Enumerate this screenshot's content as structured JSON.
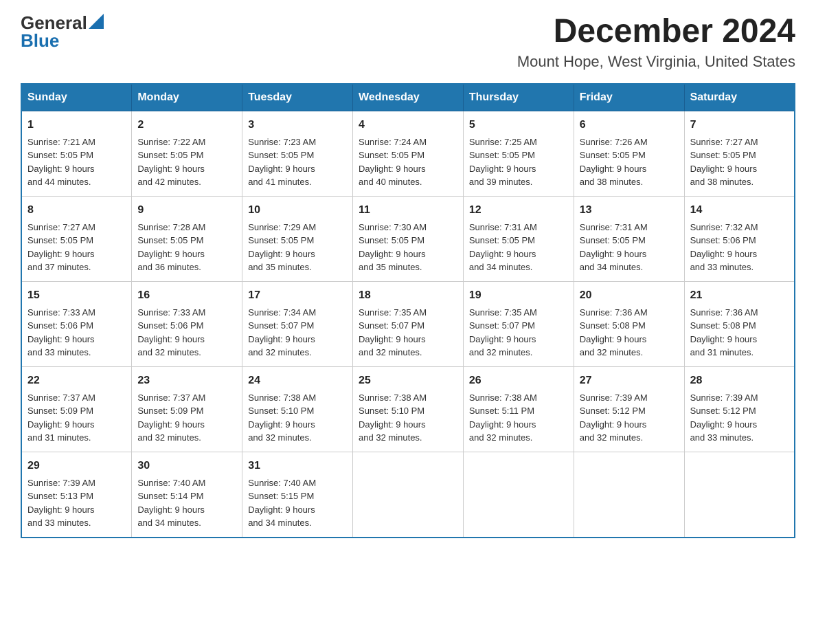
{
  "header": {
    "logo_general": "General",
    "logo_blue": "Blue",
    "month_title": "December 2024",
    "location": "Mount Hope, West Virginia, United States"
  },
  "weekdays": [
    "Sunday",
    "Monday",
    "Tuesday",
    "Wednesday",
    "Thursday",
    "Friday",
    "Saturday"
  ],
  "weeks": [
    [
      {
        "day": "1",
        "sunrise": "7:21 AM",
        "sunset": "5:05 PM",
        "daylight": "9 hours and 44 minutes."
      },
      {
        "day": "2",
        "sunrise": "7:22 AM",
        "sunset": "5:05 PM",
        "daylight": "9 hours and 42 minutes."
      },
      {
        "day": "3",
        "sunrise": "7:23 AM",
        "sunset": "5:05 PM",
        "daylight": "9 hours and 41 minutes."
      },
      {
        "day": "4",
        "sunrise": "7:24 AM",
        "sunset": "5:05 PM",
        "daylight": "9 hours and 40 minutes."
      },
      {
        "day": "5",
        "sunrise": "7:25 AM",
        "sunset": "5:05 PM",
        "daylight": "9 hours and 39 minutes."
      },
      {
        "day": "6",
        "sunrise": "7:26 AM",
        "sunset": "5:05 PM",
        "daylight": "9 hours and 38 minutes."
      },
      {
        "day": "7",
        "sunrise": "7:27 AM",
        "sunset": "5:05 PM",
        "daylight": "9 hours and 38 minutes."
      }
    ],
    [
      {
        "day": "8",
        "sunrise": "7:27 AM",
        "sunset": "5:05 PM",
        "daylight": "9 hours and 37 minutes."
      },
      {
        "day": "9",
        "sunrise": "7:28 AM",
        "sunset": "5:05 PM",
        "daylight": "9 hours and 36 minutes."
      },
      {
        "day": "10",
        "sunrise": "7:29 AM",
        "sunset": "5:05 PM",
        "daylight": "9 hours and 35 minutes."
      },
      {
        "day": "11",
        "sunrise": "7:30 AM",
        "sunset": "5:05 PM",
        "daylight": "9 hours and 35 minutes."
      },
      {
        "day": "12",
        "sunrise": "7:31 AM",
        "sunset": "5:05 PM",
        "daylight": "9 hours and 34 minutes."
      },
      {
        "day": "13",
        "sunrise": "7:31 AM",
        "sunset": "5:05 PM",
        "daylight": "9 hours and 34 minutes."
      },
      {
        "day": "14",
        "sunrise": "7:32 AM",
        "sunset": "5:06 PM",
        "daylight": "9 hours and 33 minutes."
      }
    ],
    [
      {
        "day": "15",
        "sunrise": "7:33 AM",
        "sunset": "5:06 PM",
        "daylight": "9 hours and 33 minutes."
      },
      {
        "day": "16",
        "sunrise": "7:33 AM",
        "sunset": "5:06 PM",
        "daylight": "9 hours and 32 minutes."
      },
      {
        "day": "17",
        "sunrise": "7:34 AM",
        "sunset": "5:07 PM",
        "daylight": "9 hours and 32 minutes."
      },
      {
        "day": "18",
        "sunrise": "7:35 AM",
        "sunset": "5:07 PM",
        "daylight": "9 hours and 32 minutes."
      },
      {
        "day": "19",
        "sunrise": "7:35 AM",
        "sunset": "5:07 PM",
        "daylight": "9 hours and 32 minutes."
      },
      {
        "day": "20",
        "sunrise": "7:36 AM",
        "sunset": "5:08 PM",
        "daylight": "9 hours and 32 minutes."
      },
      {
        "day": "21",
        "sunrise": "7:36 AM",
        "sunset": "5:08 PM",
        "daylight": "9 hours and 31 minutes."
      }
    ],
    [
      {
        "day": "22",
        "sunrise": "7:37 AM",
        "sunset": "5:09 PM",
        "daylight": "9 hours and 31 minutes."
      },
      {
        "day": "23",
        "sunrise": "7:37 AM",
        "sunset": "5:09 PM",
        "daylight": "9 hours and 32 minutes."
      },
      {
        "day": "24",
        "sunrise": "7:38 AM",
        "sunset": "5:10 PM",
        "daylight": "9 hours and 32 minutes."
      },
      {
        "day": "25",
        "sunrise": "7:38 AM",
        "sunset": "5:10 PM",
        "daylight": "9 hours and 32 minutes."
      },
      {
        "day": "26",
        "sunrise": "7:38 AM",
        "sunset": "5:11 PM",
        "daylight": "9 hours and 32 minutes."
      },
      {
        "day": "27",
        "sunrise": "7:39 AM",
        "sunset": "5:12 PM",
        "daylight": "9 hours and 32 minutes."
      },
      {
        "day": "28",
        "sunrise": "7:39 AM",
        "sunset": "5:12 PM",
        "daylight": "9 hours and 33 minutes."
      }
    ],
    [
      {
        "day": "29",
        "sunrise": "7:39 AM",
        "sunset": "5:13 PM",
        "daylight": "9 hours and 33 minutes."
      },
      {
        "day": "30",
        "sunrise": "7:40 AM",
        "sunset": "5:14 PM",
        "daylight": "9 hours and 34 minutes."
      },
      {
        "day": "31",
        "sunrise": "7:40 AM",
        "sunset": "5:15 PM",
        "daylight": "9 hours and 34 minutes."
      },
      null,
      null,
      null,
      null
    ]
  ],
  "labels": {
    "sunrise": "Sunrise:",
    "sunset": "Sunset:",
    "daylight": "Daylight:"
  }
}
